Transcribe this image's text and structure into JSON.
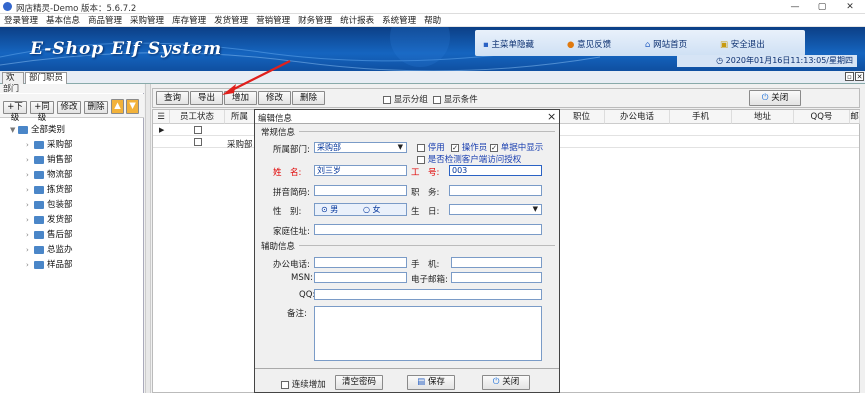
{
  "window": {
    "title": "网店精灵-Demo  版本：5.6.7.2",
    "min": "—",
    "max": "▢",
    "close": "✕"
  },
  "menu": [
    "登录管理",
    "基本信息",
    "商品管理",
    "采购管理",
    "库存管理",
    "发货管理",
    "营销管理",
    "财务管理",
    "统计报表",
    "系统管理",
    "帮助"
  ],
  "banner": {
    "logo": "E-Shop Elf System",
    "links": [
      "主菜单隐藏",
      "意见反馈",
      "网站首页",
      "安全退出"
    ],
    "datetime": "2020年01月16日11:13:05/星期四"
  },
  "tabs": [
    "欢迎",
    "部门职员"
  ],
  "left": {
    "header": "部门",
    "buttons": [
      "+下级",
      "+同级",
      "修改",
      "删除"
    ],
    "root": "全部类别",
    "departments": [
      "采购部",
      "销售部",
      "物流部",
      "拣货部",
      "包装部",
      "发货部",
      "售后部",
      "总监办",
      "样品部"
    ]
  },
  "toolbar": {
    "buttons": [
      "查询",
      "导出",
      "增加",
      "修改",
      "删除"
    ],
    "show_group": "显示分组",
    "show_cond": "显示条件",
    "close": "关闭"
  },
  "grid": {
    "columns": [
      "员工状态",
      "所属",
      "职位",
      "办公电话",
      "手机",
      "地址",
      "QQ号"
    ],
    "row_dept": "采购部",
    "more_col": "邮"
  },
  "dialog": {
    "title": "编辑信息",
    "close": "×",
    "section_general": "常规信息",
    "dept_label": "所属部门:",
    "dept_value": "采购部",
    "stop": "停用",
    "operator": "操作员",
    "single_show": "单据中显示",
    "check_auth": "是否检测客户端访问授权",
    "name_label": "姓　名:",
    "name_value": "刘三岁",
    "code_label": "工　号:",
    "code_value": "003",
    "pinyin_label": "拼音简码:",
    "duty_label": "职　务:",
    "gender_label": "性　别:",
    "male": "男",
    "female": "女",
    "birthday_label": "生　日:",
    "home_label": "家庭住址:",
    "section_aux": "辅助信息",
    "office_label": "办公电话:",
    "mobile_label": "手　机:",
    "msn_label": "MSN:",
    "email_label": "电子邮箱:",
    "qq_label": "QQ:",
    "remark_label": "备注:",
    "continue_add": "连续增加",
    "clear_pwd": "清空密码",
    "save": "保存",
    "close_btn": "关闭"
  }
}
